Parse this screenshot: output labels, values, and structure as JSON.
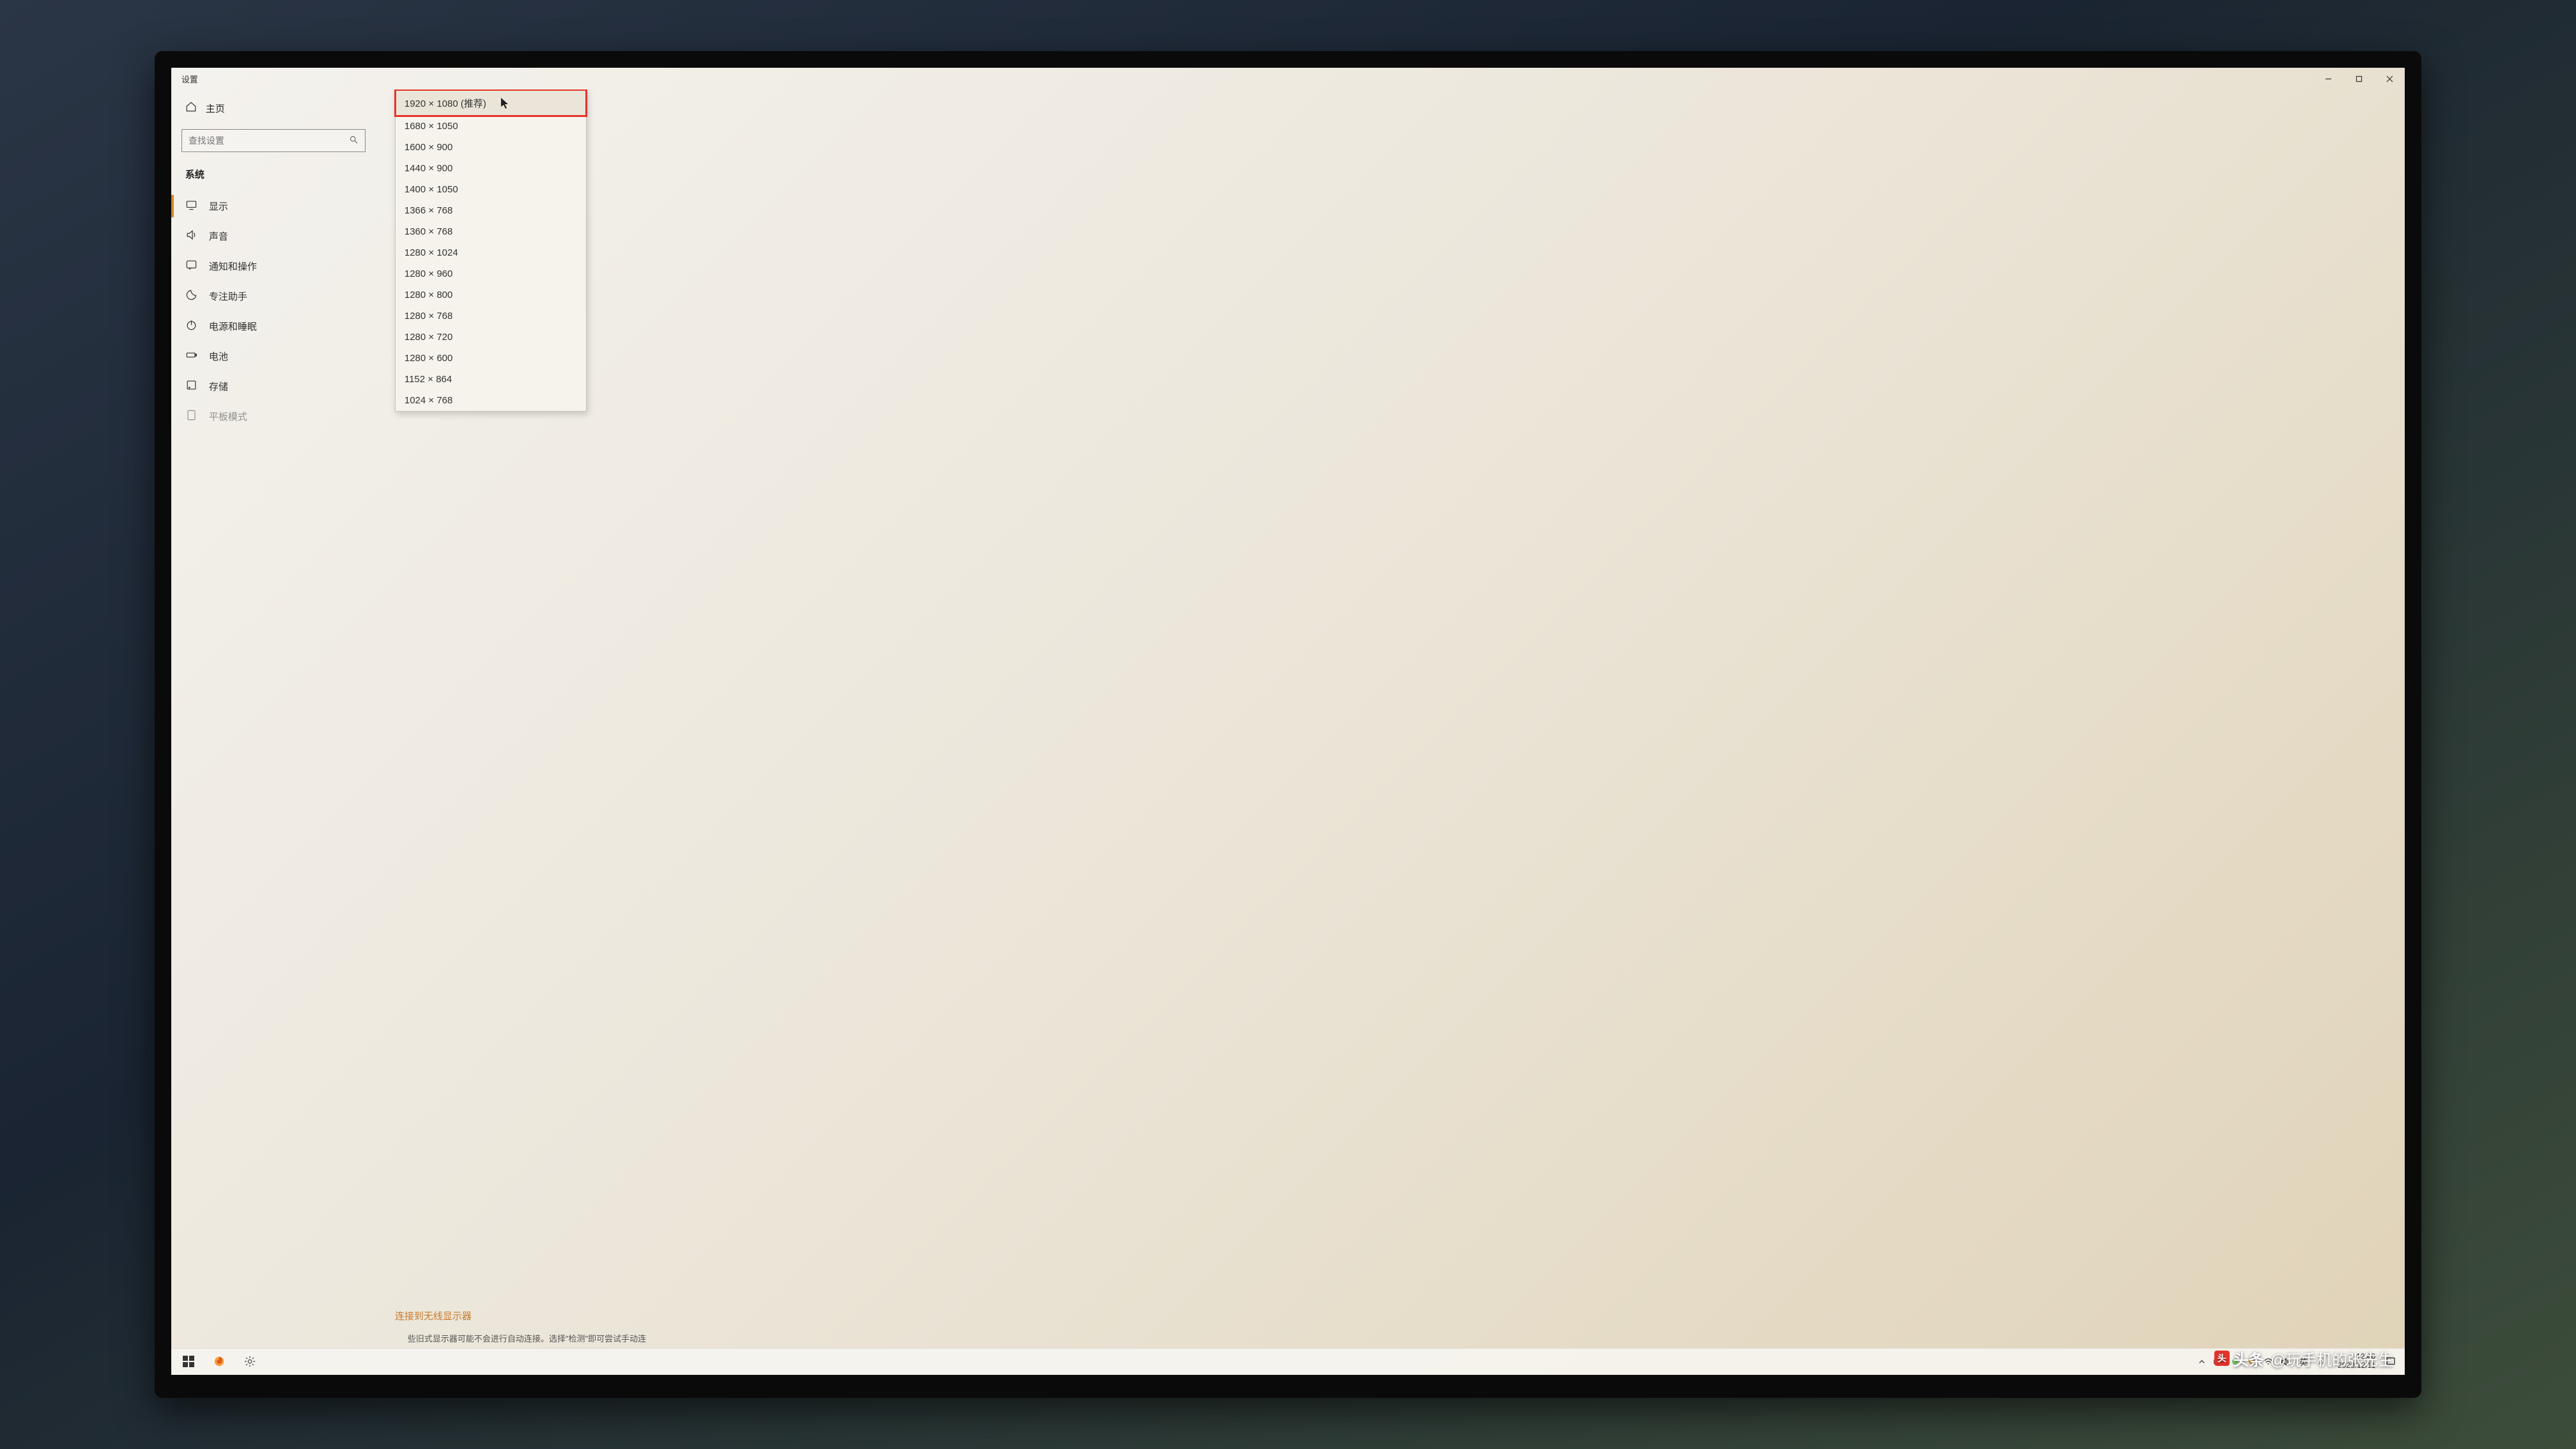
{
  "window": {
    "title": "设置"
  },
  "sidebar": {
    "home": "主页",
    "search_placeholder": "查找设置",
    "section": "系统",
    "items": [
      {
        "label": "显示"
      },
      {
        "label": "声音"
      },
      {
        "label": "通知和操作"
      },
      {
        "label": "专注助手"
      },
      {
        "label": "电源和睡眠"
      },
      {
        "label": "电池"
      },
      {
        "label": "存储"
      },
      {
        "label": "平板模式"
      }
    ]
  },
  "dropdown": {
    "selected": "1920 × 1080 (推荐)",
    "options": [
      "1680 × 1050",
      "1600 × 900",
      "1440 × 900",
      "1400 × 1050",
      "1366 × 768",
      "1360 × 768",
      "1280 × 1024",
      "1280 × 960",
      "1280 × 800",
      "1280 × 768",
      "1280 × 720",
      "1280 × 600",
      "1152 × 864",
      "1024 × 768"
    ]
  },
  "main": {
    "wireless_link": "连接到无线显示器",
    "partial_hint": "些旧式显示器可能不会进行自动连接。选择\"检测\"即可尝试手动连"
  },
  "taskbar": {
    "ime1": "英",
    "ime2": "⛬",
    "time": "12:40",
    "date": "2020/12/11"
  },
  "watermark": {
    "brand": "头条",
    "handle": "@玩手机的张先生"
  }
}
